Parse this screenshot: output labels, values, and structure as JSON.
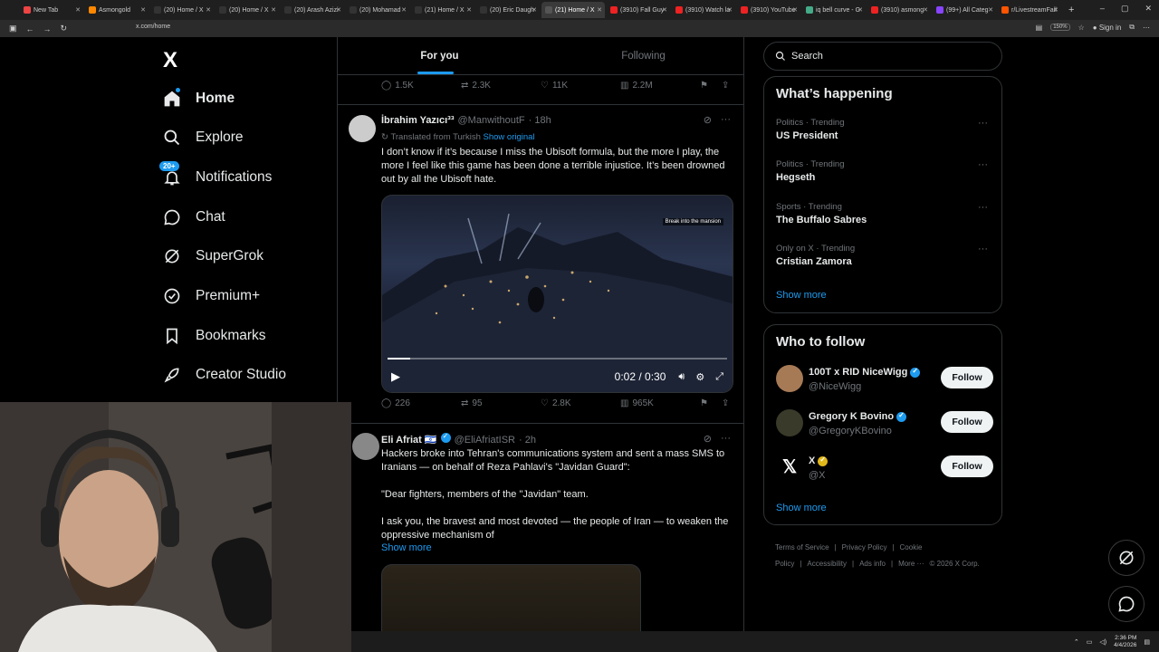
{
  "browser": {
    "tabs": [
      {
        "label": "New Tab",
        "color": "#e44"
      },
      {
        "label": "Asmongold",
        "color": "#f80"
      },
      {
        "label": "(20) Home / X",
        "color": "#333"
      },
      {
        "label": "(20) Home / X",
        "color": "#333"
      },
      {
        "label": "(20) Arash Azizi",
        "color": "#333"
      },
      {
        "label": "(20) Mohamad",
        "color": "#333"
      },
      {
        "label": "(21) Home / X",
        "color": "#333"
      },
      {
        "label": "(20) Eric Daugh",
        "color": "#333"
      },
      {
        "label": "(21) Home / X",
        "color": "#555",
        "active": true
      },
      {
        "label": "(3910) Fall Guy",
        "color": "#e22"
      },
      {
        "label": "(3910) Watch la",
        "color": "#e22"
      },
      {
        "label": "(3910) YouTube",
        "color": "#e22"
      },
      {
        "label": "iq bell curve - G",
        "color": "#4a8"
      },
      {
        "label": "(3910) asmong",
        "color": "#e22"
      },
      {
        "label": "(99+) All Categ",
        "color": "#84f"
      },
      {
        "label": "r/LivestreamFail",
        "color": "#f50"
      }
    ],
    "url": "x.com/home",
    "zoom": "150%",
    "sign_in": "Sign in"
  },
  "sidebar": {
    "logo": "X",
    "notifications_badge": "20+",
    "items": [
      {
        "label": "Home",
        "icon": "home-icon"
      },
      {
        "label": "Explore",
        "icon": "search-icon"
      },
      {
        "label": "Notifications",
        "icon": "bell-icon"
      },
      {
        "label": "Chat",
        "icon": "chat-icon"
      },
      {
        "label": "SuperGrok",
        "icon": "grok-icon"
      },
      {
        "label": "Premium+",
        "icon": "premium-icon"
      },
      {
        "label": "Bookmarks",
        "icon": "bookmark-icon"
      },
      {
        "label": "Creator Studio",
        "icon": "rocket-icon"
      }
    ]
  },
  "feed": {
    "tabs": [
      "For you",
      "Following"
    ],
    "prev_actions": {
      "replies": "1.5K",
      "reposts": "2.3K",
      "likes": "11K",
      "views": "2.2M"
    },
    "tweet1": {
      "name": "İbrahim Yazıcı³³",
      "handle": "@ManwithoutF",
      "time": "· 18h",
      "translated_label": "Translated from Turkish",
      "show_original": "Show original",
      "text": "I don’t know if it’s because I miss the Ubisoft formula, but the more I play, the more I feel like this game has been done a terrible injustice. It’s been drowned out by all the Ubisoft hate.",
      "video_label": "Break into the mansion",
      "video_time": "0:02 / 0:30",
      "video_progress": 0.067,
      "actions": {
        "replies": "226",
        "reposts": "95",
        "likes": "2.8K",
        "views": "965K"
      }
    },
    "tweet2": {
      "name": "Eli Afriat 🇮🇱",
      "handle": "@EliAfriatISR",
      "time": "· 2h",
      "p1": "Hackers broke into Tehran's communications system and sent a mass SMS to Iranians — on behalf of Reza Pahlavi's \"Javidan Guard\":",
      "p2": "\"Dear fighters, members of the \"Javidan\" team.",
      "p3": "I ask you, the bravest and most devoted — the people of Iran — to weaken the oppressive mechanism of",
      "show_more": "Show more"
    }
  },
  "right": {
    "search_placeholder": "Search",
    "happening_title": "What’s happening",
    "trends": [
      {
        "category": "Politics · Trending",
        "title": "US President"
      },
      {
        "category": "Politics · Trending",
        "title": "Hegseth"
      },
      {
        "category": "Sports · Trending",
        "title": "The Buffalo Sabres"
      },
      {
        "category": "Only on X · Trending",
        "title": "Cristian Zamora"
      }
    ],
    "show_more": "Show more",
    "wtf_title": "Who to follow",
    "who_to_follow": [
      {
        "name": "100T x RID NiceWigg",
        "handle": "@NiceWigg",
        "badge": "blue"
      },
      {
        "name": "Gregory K Bovino",
        "handle": "@GregoryKBovino",
        "badge": "blue"
      },
      {
        "name": "X",
        "handle": "@X",
        "badge": "gold"
      }
    ],
    "follow_label": "Follow",
    "footer": [
      "Terms of Service",
      "|",
      "Privacy Policy",
      "|",
      "Cookie Policy",
      "|",
      "Accessibility",
      "|",
      "Ads info",
      "|",
      "More ···",
      "© 2026 X Corp."
    ]
  },
  "taskbar": {
    "time": "2:36 PM",
    "date": "4/4/2026"
  }
}
